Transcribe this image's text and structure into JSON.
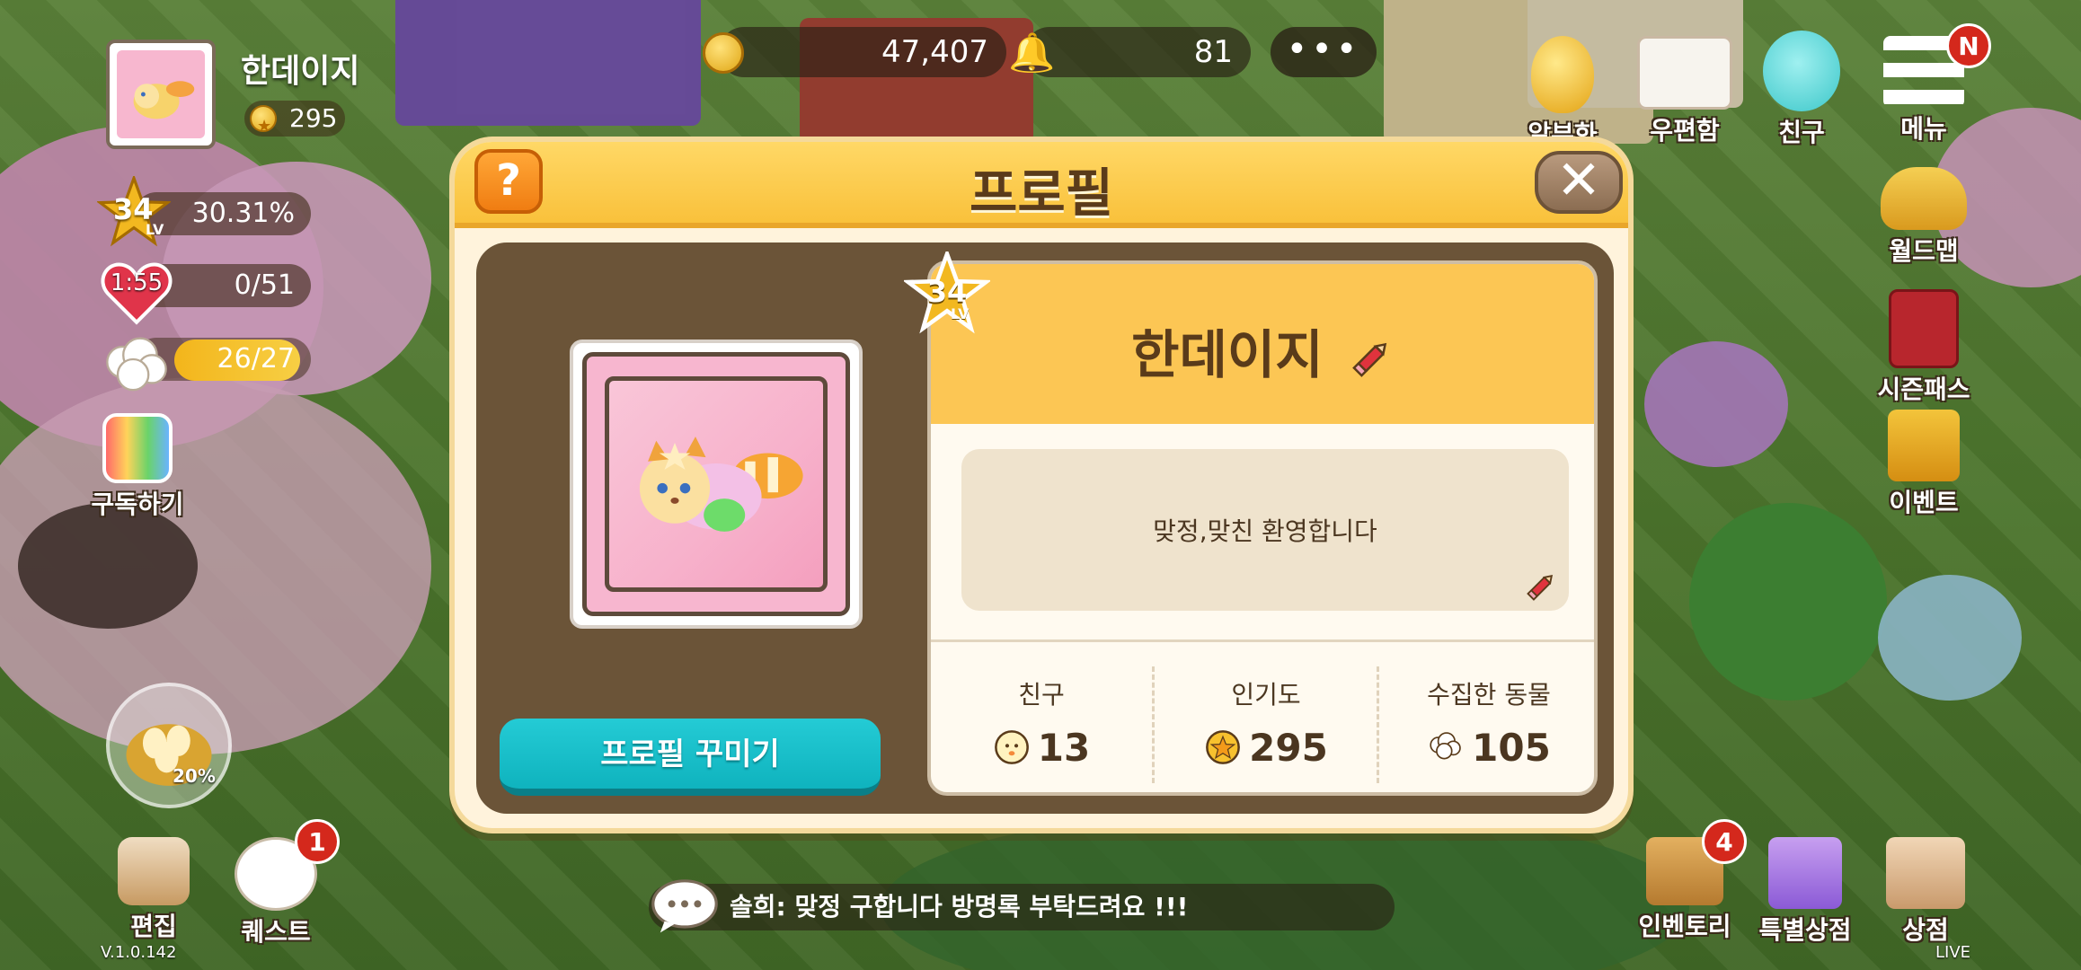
{
  "hud": {
    "player_name": "한데이지",
    "popularity": "295",
    "level": "34",
    "level_suffix": "LV",
    "exp_percent": "30.31%",
    "heart_timer": "1:55",
    "hearts": "0/51",
    "animals": "26/27",
    "coins": "47,407",
    "bells": "81",
    "more": "•••",
    "subscribe_label": "구독하기",
    "egg_progress": "20%"
  },
  "right_menu": [
    {
      "label": "알부화",
      "icon": "golden-egg-icon"
    },
    {
      "label": "우편함",
      "icon": "mail-icon"
    },
    {
      "label": "친구",
      "icon": "friend-icon"
    },
    {
      "label": "메뉴",
      "icon": "menu-icon",
      "badge": "N"
    },
    {
      "label": "월드맵",
      "icon": "airplane-icon"
    },
    {
      "label": "시즌패스",
      "icon": "passport-icon"
    },
    {
      "label": "이벤트",
      "icon": "event-box-icon"
    }
  ],
  "bottom_left": [
    {
      "label": "편집",
      "icon": "edit-brush-icon"
    },
    {
      "label": "퀘스트",
      "icon": "quest-sheep-icon",
      "badge": "1"
    }
  ],
  "bottom_right": [
    {
      "label": "인벤토리",
      "icon": "inventory-box-icon",
      "badge": "4"
    },
    {
      "label": "특별상점",
      "icon": "special-shop-bag-icon"
    },
    {
      "label": "상점",
      "icon": "shop-house-icon"
    }
  ],
  "ticker": "솔희: 맞정 구합니다 방명록 부탁드려요 !!!",
  "version": "V.1.0.142",
  "live": "LIVE",
  "modal": {
    "title": "프로필",
    "help": "?",
    "close": "✕",
    "level": "34",
    "level_suffix": "LV",
    "name": "한데이지",
    "message": "맞정,맞친 환영합니다",
    "decorate_button": "프로필 꾸미기",
    "stats": [
      {
        "label": "친구",
        "value": "13",
        "icon": "friend-face-icon"
      },
      {
        "label": "인기도",
        "value": "295",
        "icon": "popularity-coin-icon"
      },
      {
        "label": "수집한 동물",
        "value": "105",
        "icon": "sheep-icon"
      }
    ]
  },
  "colors": {
    "modal_header": "#f9c13b",
    "modal_bg": "#fff3dc",
    "panel_brown": "#6b5438",
    "button_teal": "#16bcc6",
    "badge_red": "#d4281c"
  }
}
